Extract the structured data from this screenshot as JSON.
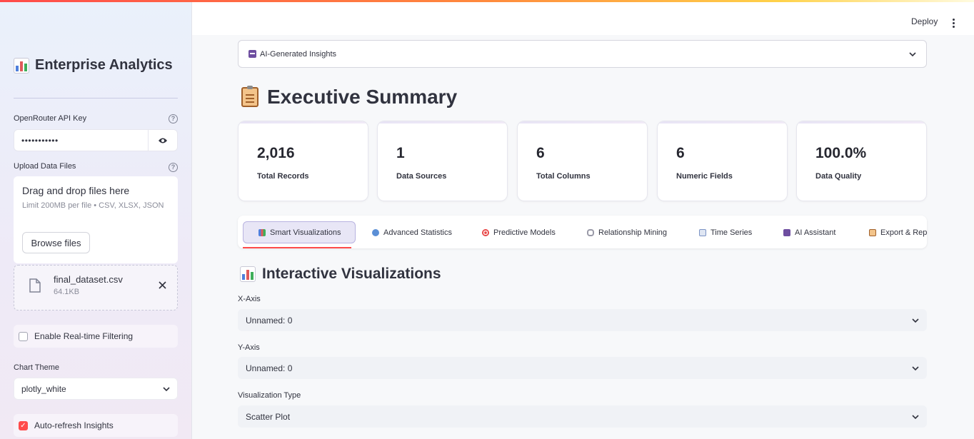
{
  "sidebar": {
    "title": "Enterprise Analytics",
    "api_key_label": "OpenRouter API Key",
    "api_key_value": "•••••••••••",
    "upload_label": "Upload Data Files",
    "uploader": {
      "title": "Drag and drop files here",
      "subtitle": "Limit 200MB per file • CSV, XLSX, JSON",
      "browse_label": "Browse files"
    },
    "file": {
      "name": "final_dataset.csv",
      "size": "64.1KB"
    },
    "realtime_filter_label": "Enable Real-time Filtering",
    "realtime_filter_checked": false,
    "chart_theme_label": "Chart Theme",
    "chart_theme_value": "plotly_white",
    "auto_refresh_label": "Auto-refresh Insights",
    "auto_refresh_checked": true
  },
  "header": {
    "deploy_label": "Deploy"
  },
  "expander": {
    "label": "AI-Generated Insights"
  },
  "summary": {
    "title": "Executive Summary",
    "metrics": [
      {
        "value": "2,016",
        "label": "Total Records"
      },
      {
        "value": "1",
        "label": "Data Sources"
      },
      {
        "value": "6",
        "label": "Total Columns"
      },
      {
        "value": "6",
        "label": "Numeric Fields"
      },
      {
        "value": "100.0%",
        "label": "Data Quality"
      }
    ]
  },
  "tabs": [
    {
      "label": "Smart Visualizations",
      "icon": "bar-chart-icon",
      "active": true
    },
    {
      "label": "Advanced Statistics",
      "icon": "magnifier-icon",
      "active": false
    },
    {
      "label": "Predictive Models",
      "icon": "target-icon",
      "active": false
    },
    {
      "label": "Relationship Mining",
      "icon": "link-icon",
      "active": false
    },
    {
      "label": "Time Series",
      "icon": "line-chart-icon",
      "active": false
    },
    {
      "label": "AI Assistant",
      "icon": "robot-icon",
      "active": false
    },
    {
      "label": "Export & Repo",
      "icon": "clipboard-icon",
      "active": false
    }
  ],
  "visualizations": {
    "title": "Interactive Visualizations",
    "x_axis_label": "X-Axis",
    "x_axis_value": "Unnamed: 0",
    "y_axis_label": "Y-Axis",
    "y_axis_value": "Unnamed: 0",
    "viz_type_label": "Visualization Type",
    "viz_type_value": "Scatter Plot"
  },
  "colors": {
    "accent": "#ff4b4b",
    "active_tab_bg": "#e8e6f6"
  }
}
